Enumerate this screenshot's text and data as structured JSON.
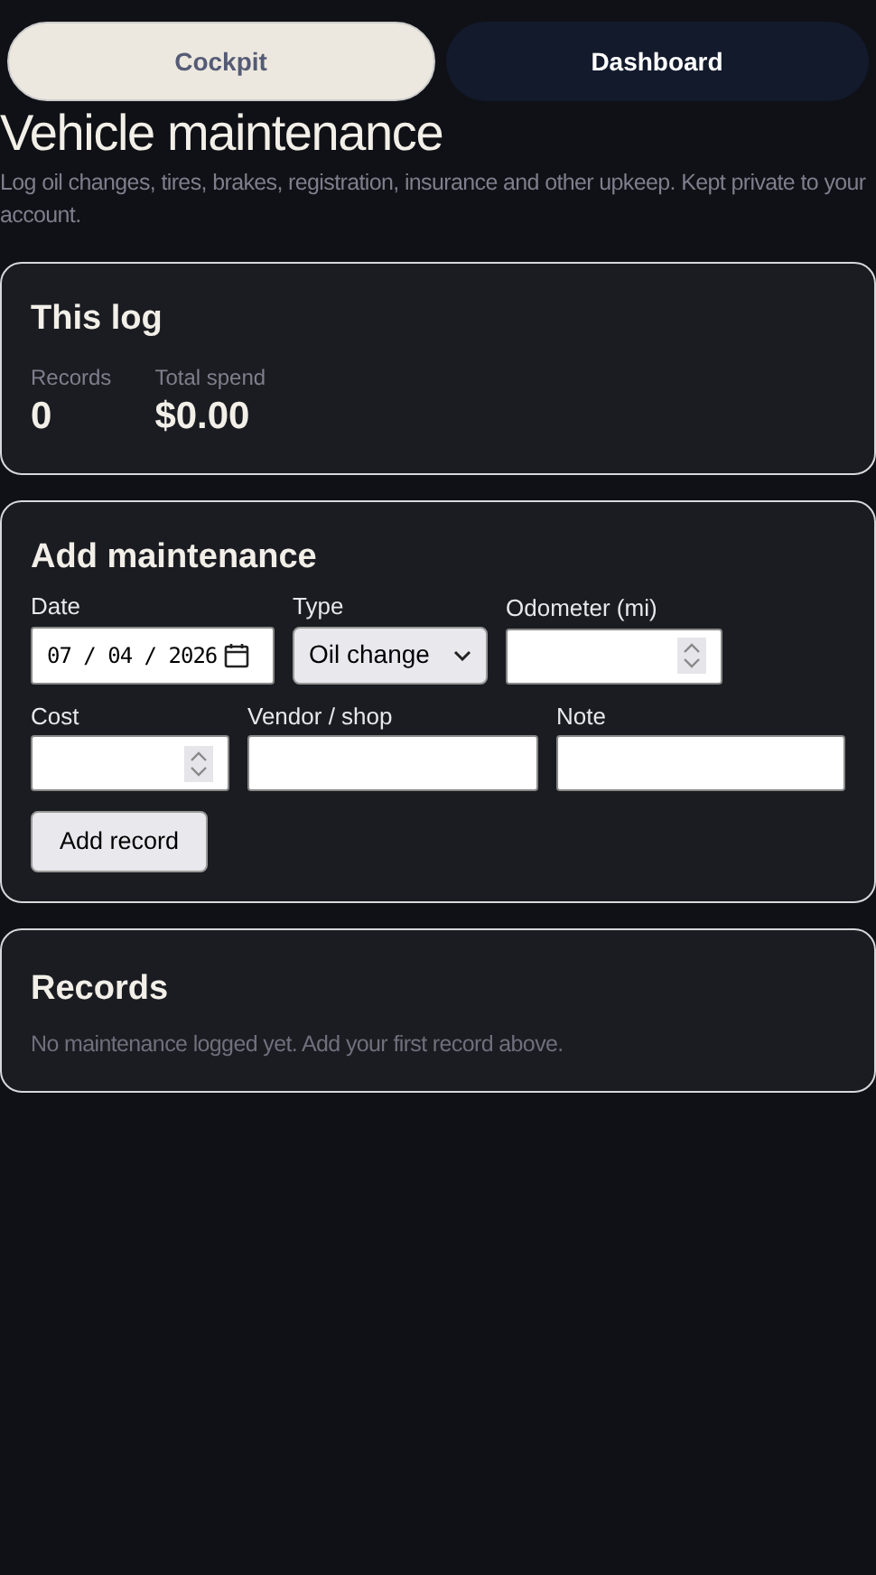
{
  "tabs": [
    {
      "label": "Cockpit",
      "selected": true
    },
    {
      "label": "Dashboard",
      "selected": false
    }
  ],
  "header": {
    "title": "Vehicle maintenance",
    "subtitle": "Log oil changes, tires, brakes, registration, insurance and other upkeep. Kept private to your account."
  },
  "summary": {
    "title": "This log",
    "stats": [
      {
        "label": "Records",
        "value": "0"
      },
      {
        "label": "Total spend",
        "value": "$0.00"
      }
    ]
  },
  "form": {
    "title": "Add maintenance",
    "rows": [
      [
        {
          "label": "Date",
          "kind": "date",
          "value": "07 / 04 / 2026"
        },
        {
          "label": "Type",
          "kind": "select",
          "value": "Oil change"
        },
        {
          "label": "Odometer (mi)",
          "kind": "number"
        }
      ],
      [
        {
          "label": "Cost",
          "kind": "number"
        },
        {
          "label": "Vendor / shop",
          "kind": "text"
        },
        {
          "label": "Note",
          "kind": "text"
        }
      ]
    ],
    "submit": "Add record"
  },
  "records": {
    "title": "Records",
    "empty": "No maintenance logged yet. Add your first record above."
  }
}
